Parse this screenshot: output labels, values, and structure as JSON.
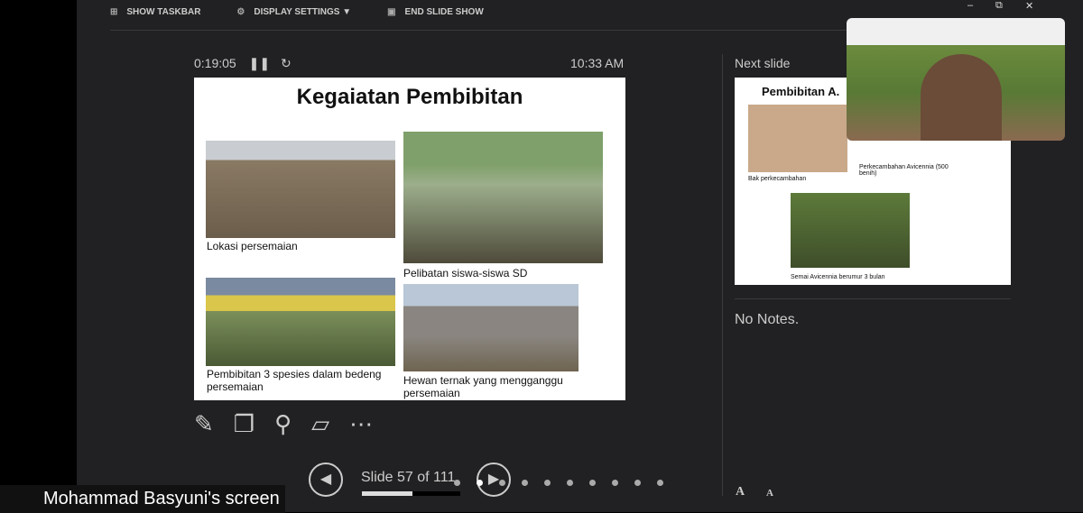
{
  "toolbar": {
    "show_taskbar": "SHOW TASKBAR",
    "display_settings": "DISPLAY SETTINGS ▼",
    "end_show": "END SLIDE SHOW"
  },
  "window": {
    "minimize": "–",
    "restore": "⧉",
    "close": "✕"
  },
  "timer": "0:19:05",
  "clock": "10:33 AM",
  "slide": {
    "title": "Kegaiatan Pembibitan",
    "captions": [
      "Lokasi persemaian",
      "Pelibatan siswa-siswa SD",
      "Pembibitan 3 spesies dalam bedeng persemaian",
      "Hewan ternak yang mengganggu persemaian"
    ]
  },
  "navigation": {
    "slide_label": "Slide 57 of 111",
    "progress": 0.51
  },
  "next": {
    "label": "Next slide",
    "title": "Pembibitan A.",
    "captions": [
      "Bak perkecambahan",
      "Perkecambahan Avicennia (500 benih)",
      "Semai Avicennia berumur 3 bulan"
    ]
  },
  "notes": "No Notes.",
  "font_buttons": {
    "increase": "A",
    "decrease": "A"
  },
  "screen_label": "Mohammad Basyuni's screen"
}
